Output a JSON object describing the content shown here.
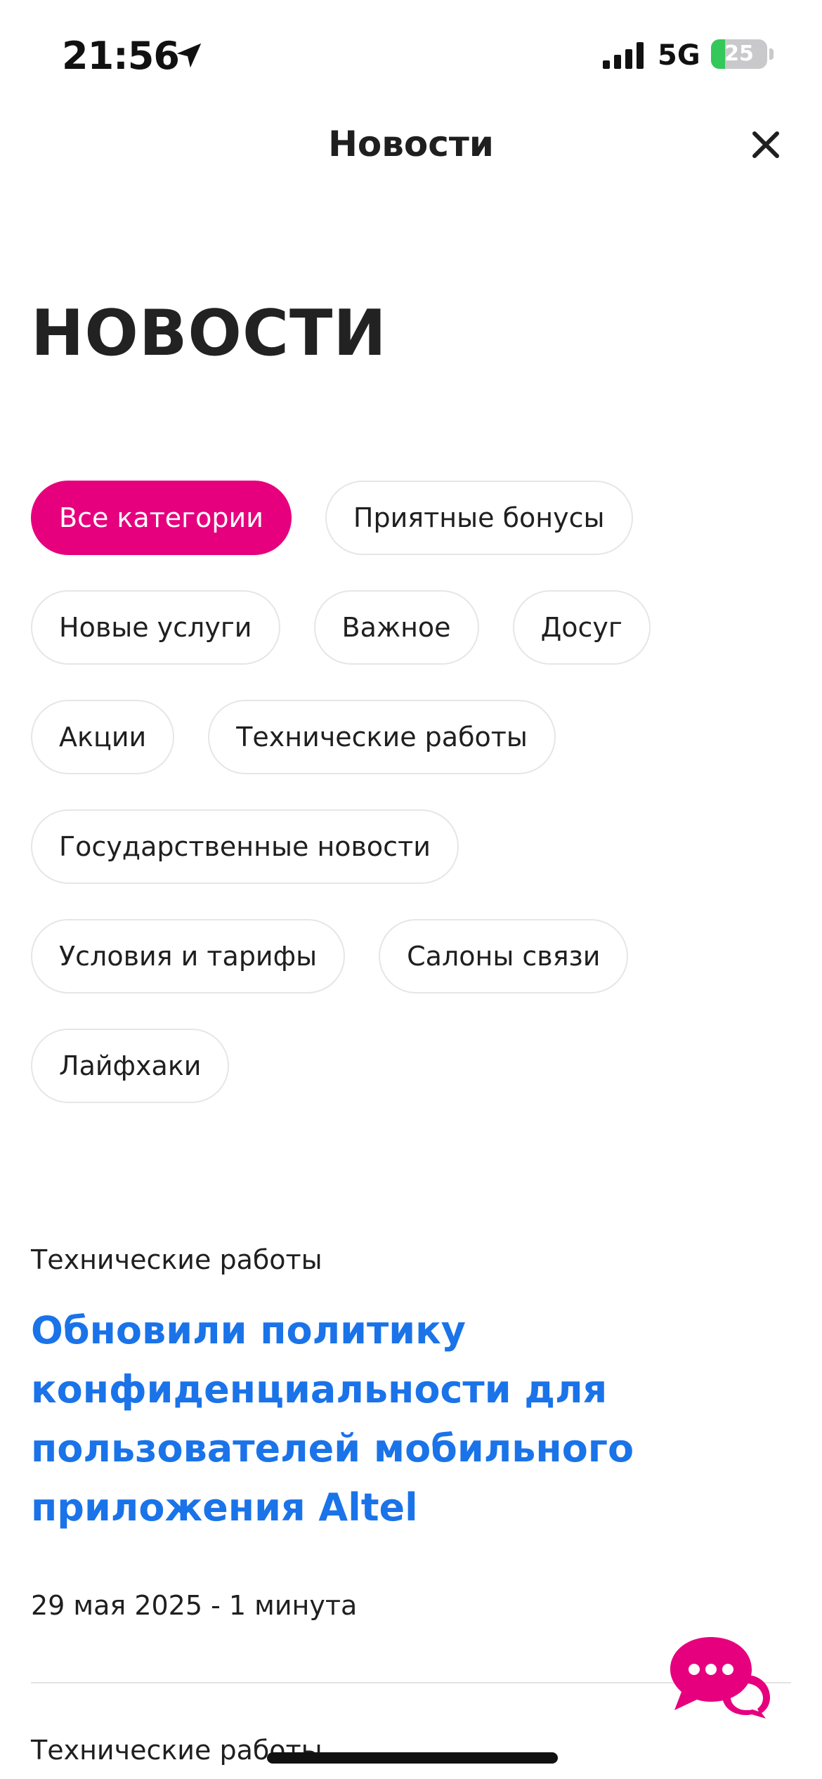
{
  "status_bar": {
    "time": "21:56",
    "network": "5G",
    "battery_percent": 25,
    "battery_label": "25",
    "battery_color": "#34c759"
  },
  "header": {
    "title": "Новости",
    "close_icon": "close-icon"
  },
  "page": {
    "title": "НОВОСТИ"
  },
  "categories": [
    {
      "label": "Все категории",
      "active": true
    },
    {
      "label": "Приятные бонусы",
      "active": false
    },
    {
      "label": "Новые услуги",
      "active": false
    },
    {
      "label": "Важное",
      "active": false
    },
    {
      "label": "Досуг",
      "active": false
    },
    {
      "label": "Акции",
      "active": false
    },
    {
      "label": "Технические работы",
      "active": false
    },
    {
      "label": "Государственные новости",
      "active": false
    },
    {
      "label": "Условия и тарифы",
      "active": false
    },
    {
      "label": "Салоны связи",
      "active": false
    },
    {
      "label": "Лайфхаки",
      "active": false
    }
  ],
  "news": [
    {
      "category": "Технические работы",
      "title": "Обновили политику конфиденциальности для пользователей мобильного приложения Altel",
      "meta": "29 мая 2025 - 1 минута"
    },
    {
      "category": "Технические работы"
    }
  ],
  "colors": {
    "accent": "#e6007e",
    "link": "#1a73e8"
  },
  "icons": {
    "chat": "chat-bubble-icon",
    "location": "location-arrow-icon",
    "signal": "cellular-signal-icon"
  }
}
